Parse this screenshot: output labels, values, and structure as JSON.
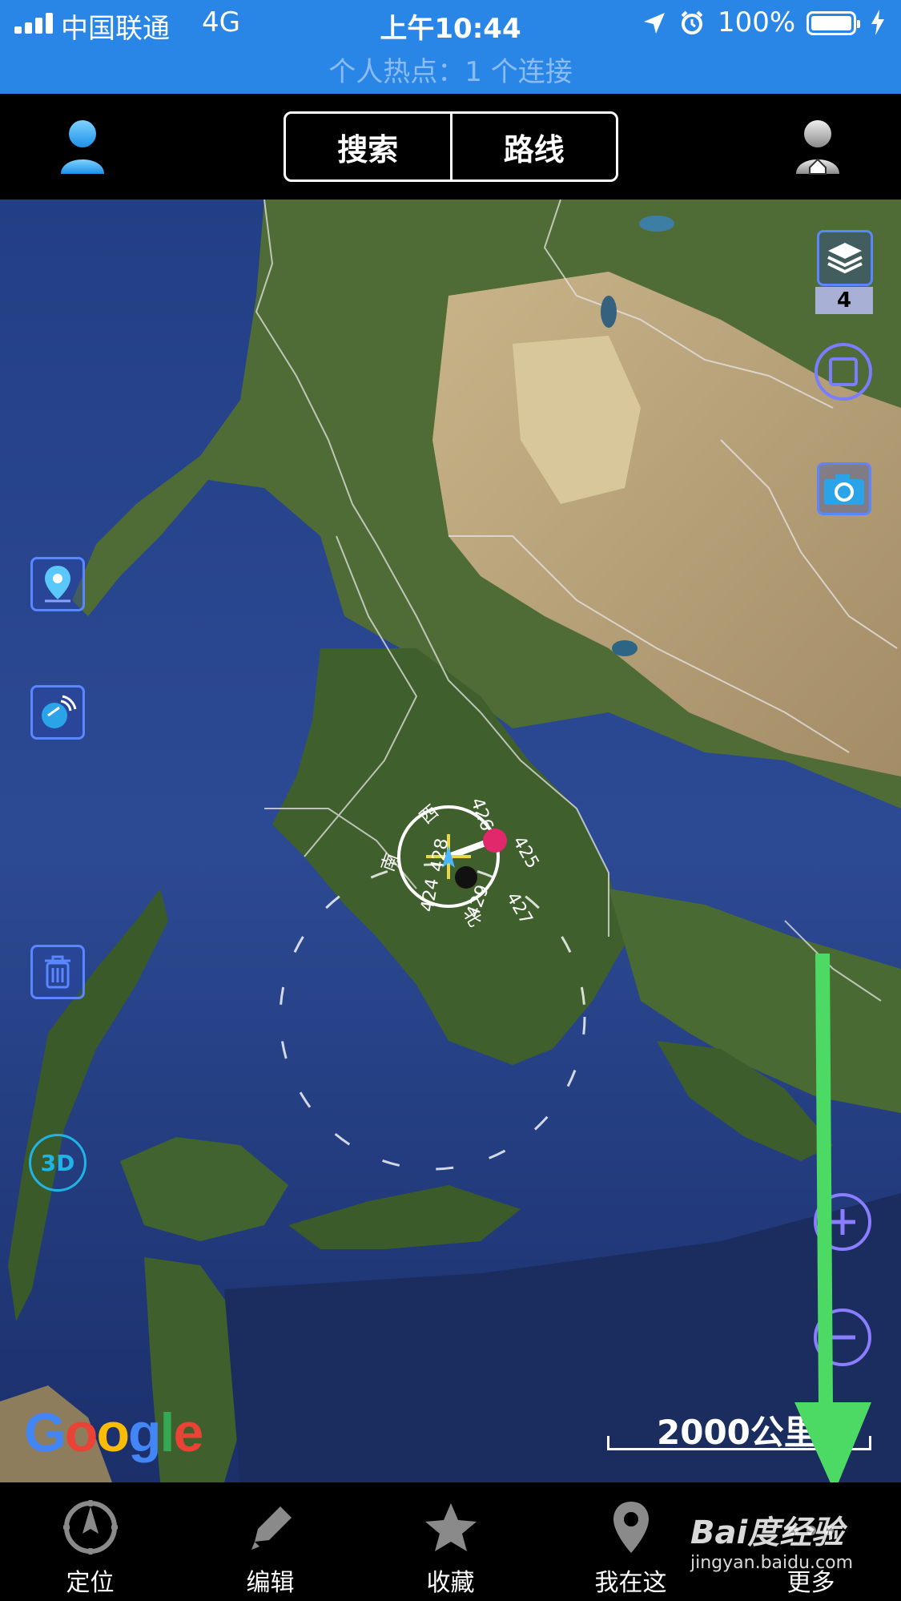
{
  "status_bar": {
    "carrier": "中国联通",
    "network": "4G",
    "time": "上午10:44",
    "battery": "100%",
    "hotspot": "个人热点：1 个连接"
  },
  "top_nav": {
    "search_label": "搜索",
    "route_label": "路线"
  },
  "map": {
    "layer_count": "4",
    "compass_labels": [
      "西",
      "南",
      "北",
      "426",
      "425",
      "427",
      "429",
      "424",
      "428"
    ],
    "attribution": "Google",
    "scale_label": "2000公里",
    "controls": [
      "layers-icon",
      "square-icon",
      "camera-icon",
      "location-pin-icon",
      "radar-icon",
      "trash-icon",
      "3d-icon",
      "zoom-in-icon",
      "zoom-out-icon"
    ]
  },
  "tab_bar": {
    "items": [
      {
        "label": "定位",
        "icon": "compass-icon"
      },
      {
        "label": "编辑",
        "icon": "pencil-icon"
      },
      {
        "label": "收藏",
        "icon": "star-icon"
      },
      {
        "label": "我在这",
        "icon": "pin-icon"
      },
      {
        "label": "更多",
        "icon": "more-icon"
      }
    ]
  },
  "watermark": {
    "main": "Bai度经验",
    "sub": "jingyan.baidu.com"
  },
  "colors": {
    "status_bar_bg": "#2a86e6",
    "control_accent": "#5a86ff",
    "annotation_arrow": "#4cd964"
  }
}
